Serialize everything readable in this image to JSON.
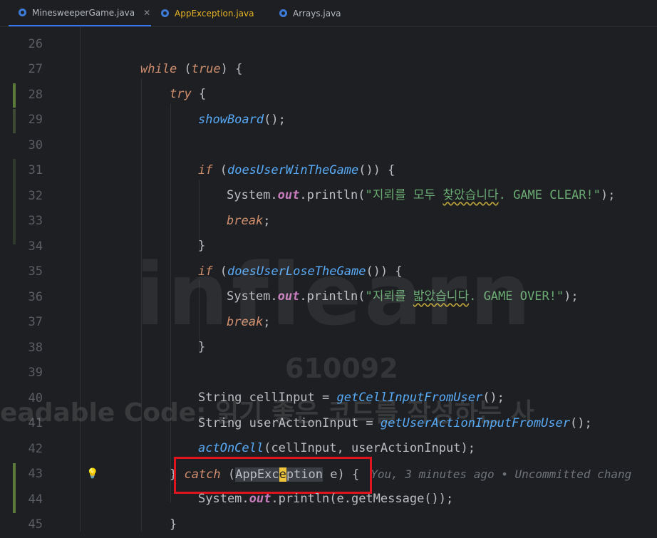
{
  "tabs": [
    {
      "label": "MinesweeperGame.java",
      "active": true,
      "closable": true
    },
    {
      "label": "AppException.java",
      "active": false,
      "error": true
    },
    {
      "label": "Arrays.java",
      "active": false
    }
  ],
  "lines": [
    {
      "num": "26"
    },
    {
      "num": "27"
    },
    {
      "num": "28"
    },
    {
      "num": "29"
    },
    {
      "num": "30"
    },
    {
      "num": "31"
    },
    {
      "num": "32"
    },
    {
      "num": "33"
    },
    {
      "num": "34"
    },
    {
      "num": "35"
    },
    {
      "num": "36"
    },
    {
      "num": "37"
    },
    {
      "num": "38"
    },
    {
      "num": "39"
    },
    {
      "num": "40"
    },
    {
      "num": "41"
    },
    {
      "num": "42"
    },
    {
      "num": "43"
    },
    {
      "num": "44"
    },
    {
      "num": "45"
    }
  ],
  "code": {
    "l27": {
      "kw_while": "while",
      "p1": " (",
      "kw_true": "true",
      "p2": ") {"
    },
    "l28": {
      "kw_try": "try",
      "p1": " {"
    },
    "l29": {
      "fn": "showBoard",
      "p1": "();"
    },
    "l31": {
      "kw_if": "if",
      "p1": " (",
      "fn": "doesUserWinTheGame",
      "p2": "()) {"
    },
    "l32": {
      "cls": "System.",
      "fld": "out",
      "p1": ".println(",
      "str_a": "\"지뢰를 모두 ",
      "str_b": "찾았습니다",
      "str_c": ". GAME CLEAR!\"",
      "p2": ");"
    },
    "l33": {
      "kw": "break",
      "p1": ";"
    },
    "l34": {
      "p1": "}"
    },
    "l35": {
      "kw_if": "if",
      "p1": " (",
      "fn": "doesUserLoseTheGame",
      "p2": "()) {"
    },
    "l36": {
      "cls": "System.",
      "fld": "out",
      "p1": ".println(",
      "str_a": "\"지뢰를 ",
      "str_b": "밟았습니다",
      "str_c": ". GAME OVER!\"",
      "p2": ");"
    },
    "l37": {
      "kw": "break",
      "p1": ";"
    },
    "l38": {
      "p1": "}"
    },
    "l40": {
      "type": "String",
      "p1": " cellInput = ",
      "fn": "getCellInputFromUser",
      "p2": "();"
    },
    "l41": {
      "type": "String",
      "p1": " userActionInput = ",
      "fn": "getUserActionInputFromUser",
      "p2": "();"
    },
    "l42": {
      "fn": "actOnCell",
      "p1": "(cellInput, userActionInput);"
    },
    "l43": {
      "p0": "} ",
      "kw": "catch",
      "p1": " (",
      "cls_a": "AppExc",
      "cls_b": "e",
      "cls_c": "ption",
      "p2": " e) {",
      "inlay": "You, 3 minutes ago • Uncommitted chang"
    },
    "l44": {
      "cls": "System.",
      "fld": "out",
      "p1": ".println(e.getMessage());"
    },
    "l45": {
      "p1": "}"
    }
  },
  "watermark": {
    "logo": "inflearn",
    "number": "610092",
    "subtitle": "eadable Code: 읽기 좋은 코드를 작성하는 사"
  },
  "colors": {
    "keyword": "#cf8e6d",
    "method": "#57aaf7",
    "string": "#6aab73",
    "field": "#c77dbb",
    "highlight_box": "#e0141e"
  },
  "icons": {
    "tab_file": "java-file-icon",
    "gutter": "lightbulb-icon"
  }
}
